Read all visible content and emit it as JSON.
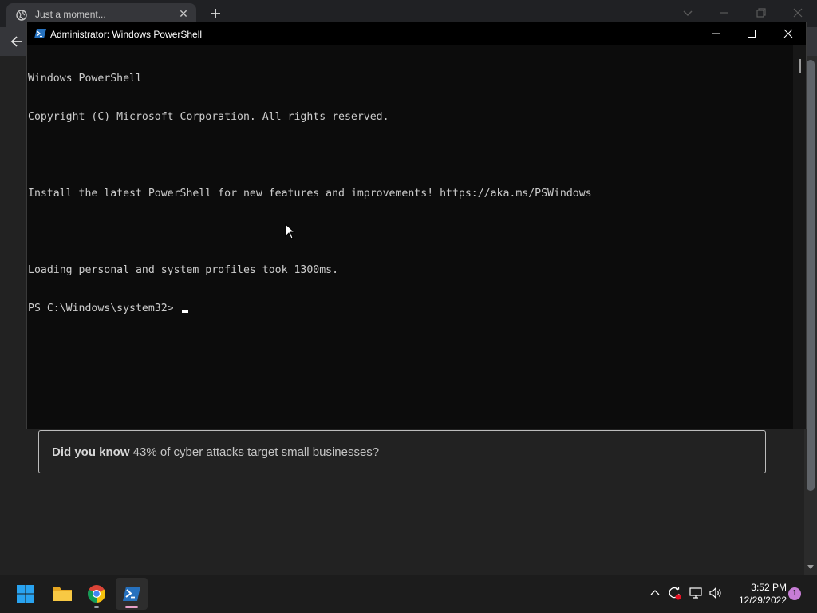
{
  "browser": {
    "tab_title": "Just a moment...",
    "tab_close": "✕",
    "tip_bold": "Did you know",
    "tip_rest": " 43% of cyber attacks target small businesses?"
  },
  "powershell": {
    "window_title": "Administrator: Windows PowerShell",
    "lines": [
      "Windows PowerShell",
      "Copyright (C) Microsoft Corporation. All rights reserved.",
      "",
      "Install the latest PowerShell for new features and improvements! https://aka.ms/PSWindows",
      "",
      "Loading personal and system profiles took 1300ms.",
      "PS C:\\Windows\\system32> "
    ]
  },
  "taskbar": {
    "apps": [
      "start-icon",
      "file-explorer-icon",
      "chrome-icon",
      "powershell-icon"
    ],
    "time": "3:52 PM",
    "date": "12/29/2022",
    "notification_count": "1"
  },
  "colors": {
    "console_bg": "#0c0c0c",
    "console_text": "#cccccc",
    "taskbar_bg": "#1c1c1c",
    "start_blue": "#29a3f0"
  }
}
